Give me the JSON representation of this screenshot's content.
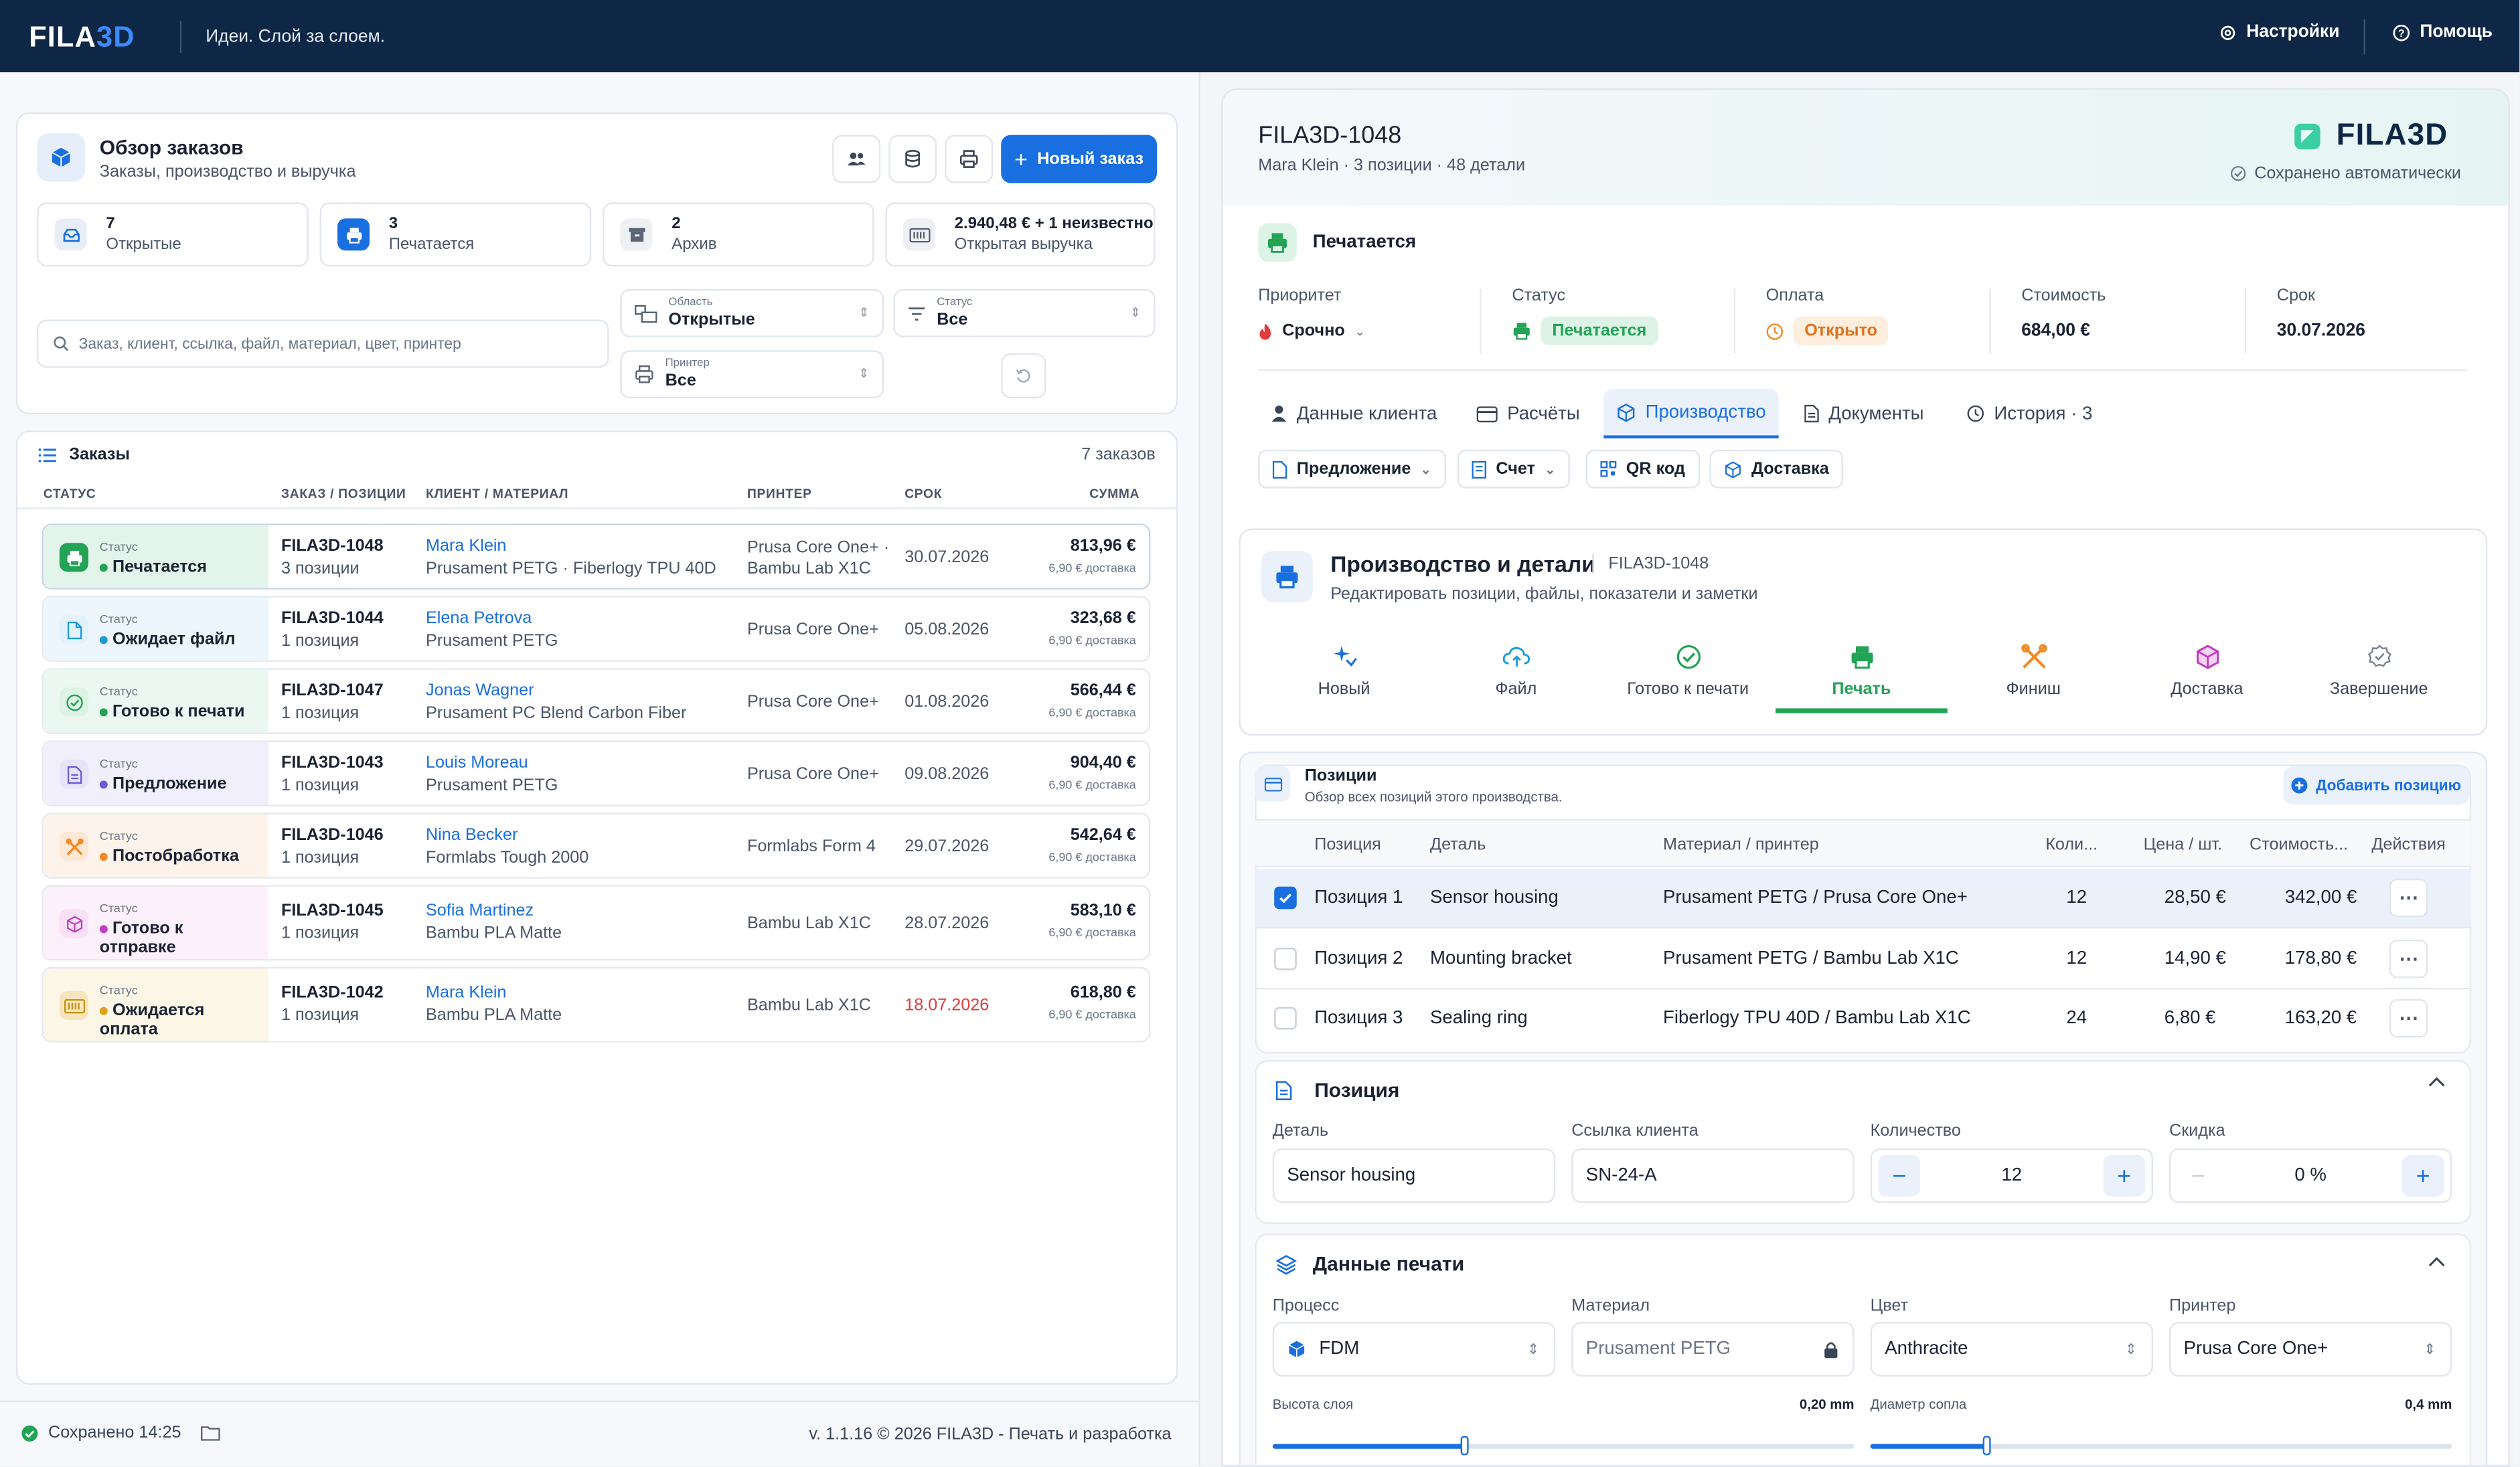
{
  "brand": {
    "logo_main": "FILA",
    "logo_accent": "3D",
    "tagline": "Идеи. Слой за слоем."
  },
  "topbar": {
    "settings": "Настройки",
    "help": "Помощь"
  },
  "overview": {
    "title": "Обзор заказов",
    "subtitle": "Заказы, производство и выручка",
    "new_order": "Новый заказ",
    "stats": [
      {
        "value": "7",
        "label": "Открытые"
      },
      {
        "value": "3",
        "label": "Печатается"
      },
      {
        "value": "2",
        "label": "Архив"
      },
      {
        "value": "2.940,48 € + 1 неизвестно",
        "label": "Открытая выручка"
      }
    ],
    "search_placeholder": "Заказ, клиент, ссылка, файл, материал, цвет, принтер",
    "filters": {
      "area_label": "Область",
      "area_value": "Открытые",
      "status_label": "Статус",
      "status_value": "Все",
      "printer_label": "Принтер",
      "printer_value": "Все"
    }
  },
  "orders": {
    "title": "Заказы",
    "count": "7 заказов",
    "columns": [
      "СТАТУС",
      "ЗАКАЗ / ПОЗИЦИИ",
      "КЛИЕНТ / МАТЕРИАЛ",
      "ПРИНТЕР",
      "СРОК",
      "СУММА"
    ],
    "status_label": "Статус",
    "rows": [
      {
        "status": "Печатается",
        "id": "FILA3D-1048",
        "positions": "3 позиции",
        "client": "Mara Klein",
        "material": "Prusament PETG · Fiberlogy TPU 40D",
        "printer": "Prusa Core One+ ·",
        "printer2": "Bambu Lab X1C",
        "due": "30.07.2026",
        "sum": "813,96 €",
        "shipping": "6,90 € доставка"
      },
      {
        "status": "Ожидает файл",
        "id": "FILA3D-1044",
        "positions": "1 позиция",
        "client": "Elena Petrova",
        "material": "Prusament PETG",
        "printer": "Prusa Core One+",
        "printer2": "",
        "due": "05.08.2026",
        "sum": "323,68 €",
        "shipping": "6,90 € доставка"
      },
      {
        "status": "Готово к печати",
        "id": "FILA3D-1047",
        "positions": "1 позиция",
        "client": "Jonas Wagner",
        "material": "Prusament PC Blend Carbon Fiber",
        "printer": "Prusa Core One+",
        "printer2": "",
        "due": "01.08.2026",
        "sum": "566,44 €",
        "shipping": "6,90 € доставка"
      },
      {
        "status": "Предложение",
        "id": "FILA3D-1043",
        "positions": "1 позиция",
        "client": "Louis Moreau",
        "material": "Prusament PETG",
        "printer": "Prusa Core One+",
        "printer2": "",
        "due": "09.08.2026",
        "sum": "904,40 €",
        "shipping": "6,90 € доставка"
      },
      {
        "status": "Постобработка",
        "id": "FILA3D-1046",
        "positions": "1 позиция",
        "client": "Nina Becker",
        "material": "Formlabs Tough 2000",
        "printer": "Formlabs Form 4",
        "printer2": "",
        "due": "29.07.2026",
        "sum": "542,64 €",
        "shipping": "6,90 € доставка"
      },
      {
        "status": "Готово к",
        "status2": "отправке",
        "id": "FILA3D-1045",
        "positions": "1 позиция",
        "client": "Sofia Martinez",
        "material": "Bambu PLA Matte",
        "printer": "Bambu Lab X1C",
        "printer2": "",
        "due": "28.07.2026",
        "sum": "583,10 €",
        "shipping": "6,90 € доставка"
      },
      {
        "status": "Ожидается",
        "status2": "оплата",
        "id": "FILA3D-1042",
        "positions": "1 позиция",
        "client": "Mara Klein",
        "material": "Bambu PLA Matte",
        "printer": "Bambu Lab X1C",
        "printer2": "",
        "due": "18.07.2026",
        "sum": "618,80 €",
        "shipping": "6,90 € доставка"
      }
    ]
  },
  "footer": {
    "saved": "Сохранено 14:25",
    "version": "v. 1.1.16 © 2026 FILA3D - Печать и разработка"
  },
  "detail": {
    "id": "FILA3D-1048",
    "sub": "Mara Klein · 3 позиции · 48 детали",
    "autosave": "Сохранено автоматически",
    "state": "Печатается",
    "meta": {
      "priority_label": "Приоритет",
      "priority": "Срочно",
      "status_label": "Статус",
      "status": "Печатается",
      "payment_label": "Оплата",
      "payment": "Открыто",
      "cost_label": "Стоимость",
      "cost": "684,00 €",
      "due_label": "Срок",
      "due": "30.07.2026"
    },
    "tabs": [
      "Данные клиента",
      "Расчёты",
      "Производство",
      "Документы",
      "История · 3"
    ],
    "doc_buttons": [
      "Предложение",
      "Счет",
      "QR код",
      "Доставка"
    ],
    "production": {
      "title": "Производство и детали",
      "ref": "FILA3D-1048",
      "subtitle": "Редактировать позиции, файлы, показатели и заметки",
      "steps": [
        "Новый",
        "Файл",
        "Готово к печати",
        "Печать",
        "Финиш",
        "Доставка",
        "Завершение"
      ]
    },
    "positions": {
      "title": "Позиции",
      "subtitle": "Обзор всех позиций этого производства.",
      "add": "Добавить позицию",
      "columns": [
        "Позиция",
        "Деталь",
        "Материал / принтер",
        "Коли...",
        "Цена / шт.",
        "Стоимость...",
        "Действия"
      ],
      "rows": [
        {
          "pos": "Позиция 1",
          "part": "Sensor housing",
          "mat": "Prusament PETG / Prusa Core One+",
          "qty": "12",
          "price": "28,50 €",
          "total": "342,00 €"
        },
        {
          "pos": "Позиция 2",
          "part": "Mounting bracket",
          "mat": "Prusament PETG / Bambu Lab X1C",
          "qty": "12",
          "price": "14,90 €",
          "total": "178,80 €"
        },
        {
          "pos": "Позиция 3",
          "part": "Sealing ring",
          "mat": "Fiberlogy TPU 40D / Bambu Lab X1C",
          "qty": "24",
          "price": "6,80 €",
          "total": "163,20 €"
        }
      ]
    },
    "position_edit": {
      "title": "Позиция",
      "part_label": "Деталь",
      "part": "Sensor housing",
      "ref_label": "Ссылка клиента",
      "ref": "SN-24-A",
      "qty_label": "Количество",
      "qty": "12",
      "disc_label": "Скидка",
      "disc": "0 %"
    },
    "print_data": {
      "title": "Данные печати",
      "process_label": "Процесс",
      "process": "FDM",
      "material_label": "Материал",
      "material": "Prusament PETG",
      "color_label": "Цвет",
      "color": "Anthracite",
      "printer_label": "Принтер",
      "printer": "Prusa Core One+",
      "layer_label": "Высота слоя",
      "layer": "0,20 mm",
      "layer_fraction": 0.33,
      "nozzle_label": "Диаметр сопла",
      "nozzle": "0,4 mm",
      "nozzle_fraction": 0.2
    }
  },
  "colors": {
    "topbar": "#0f2747",
    "accent": "#1a6fe0",
    "success": "#22a355",
    "warning": "#f08a24",
    "danger": "#e23b3b"
  }
}
